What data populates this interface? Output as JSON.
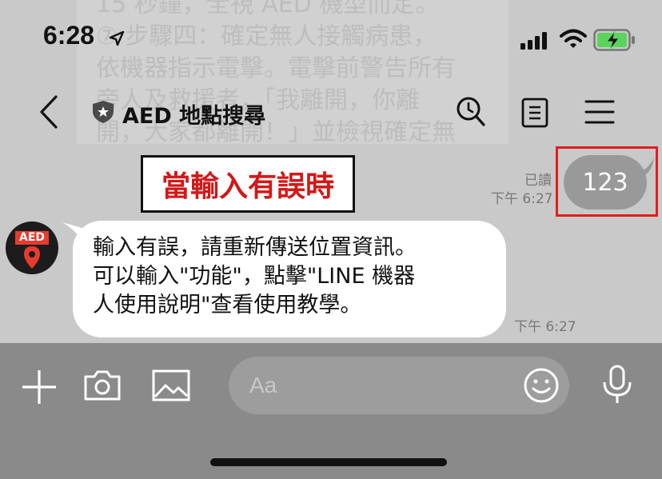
{
  "background_text": "15 秒鐘，全視 AED 機型而定。\n⑦ 步驟四：確定無人接觸病患，\n依機器指示電擊。電擊前警告所有\n旁人及救援者，「我離開，你離\n開，大家都離開！」並檢視確定無",
  "status_bar": {
    "time": "6:28"
  },
  "header": {
    "title": "AED 地點搜尋"
  },
  "annotation": {
    "label": "當輸入有誤時"
  },
  "messages": {
    "sent": {
      "text": "123",
      "read_status": "已讀",
      "time": "下午 6:27"
    },
    "received": {
      "avatar_text": "AED",
      "lines": [
        "輸入有誤，請重新傳送位置資訊。",
        "可以輸入\"功能\"，點擊\"LINE 機器",
        "人使用說明\"查看使用教學。"
      ],
      "time": "下午 6:27"
    }
  },
  "input": {
    "placeholder": "Aa"
  },
  "colors": {
    "annotation_text": "#d31818",
    "highlight_border": "#e11d1d",
    "sent_bubble": "#999999"
  }
}
